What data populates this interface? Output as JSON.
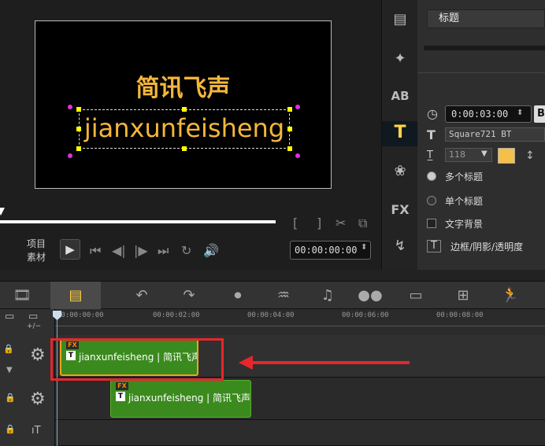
{
  "preview": {
    "title_line1": "简讯飞声",
    "title_line2": "jianxunfeisheng",
    "project_label": "项目",
    "clip_label": "素材",
    "timecode": "00:00:00:00"
  },
  "properties": {
    "panel_title": "标题",
    "duration": "0:00:03:00",
    "bold_label": "B",
    "font_name": "Square721 BT",
    "font_size": "118",
    "text_color": "#f5c04a",
    "multi_title_label": "多个标题",
    "single_title_label": "单个标题",
    "text_bg_label": "文字背景",
    "border_shadow_label": "边框/阴影/透明度"
  },
  "ruler": {
    "ticks": [
      "00:00:00:00",
      "00:00:02:00",
      "00:00:04:00",
      "00:00:06:00",
      "00:00:08:00"
    ]
  },
  "tracks": {
    "clip1_text": "jianxunfeisheng | 简讯飞声",
    "clip2_text": "jianxunfeisheng | 简讯飞声",
    "fx_badge": "FX",
    "title_badge": "T"
  },
  "icons": {
    "strip": [
      "media-icon",
      "instant-project-icon",
      "transition-icon",
      "title-icon",
      "graphic-icon",
      "filter-icon",
      "path-icon"
    ],
    "tools": [
      "storyboard-view-icon",
      "timeline-view-icon",
      "undo-icon",
      "redo-icon",
      "record-capture-icon",
      "audio-mixer-icon",
      "auto-music-icon",
      "motion-track-icon",
      "subtitle-editor-icon",
      "multi-camera-icon",
      "speed-icon"
    ]
  },
  "colors": {
    "accent_title": "#f5b63a",
    "clip_green": "#3b8a1e",
    "annotation_red": "#e8262c"
  }
}
